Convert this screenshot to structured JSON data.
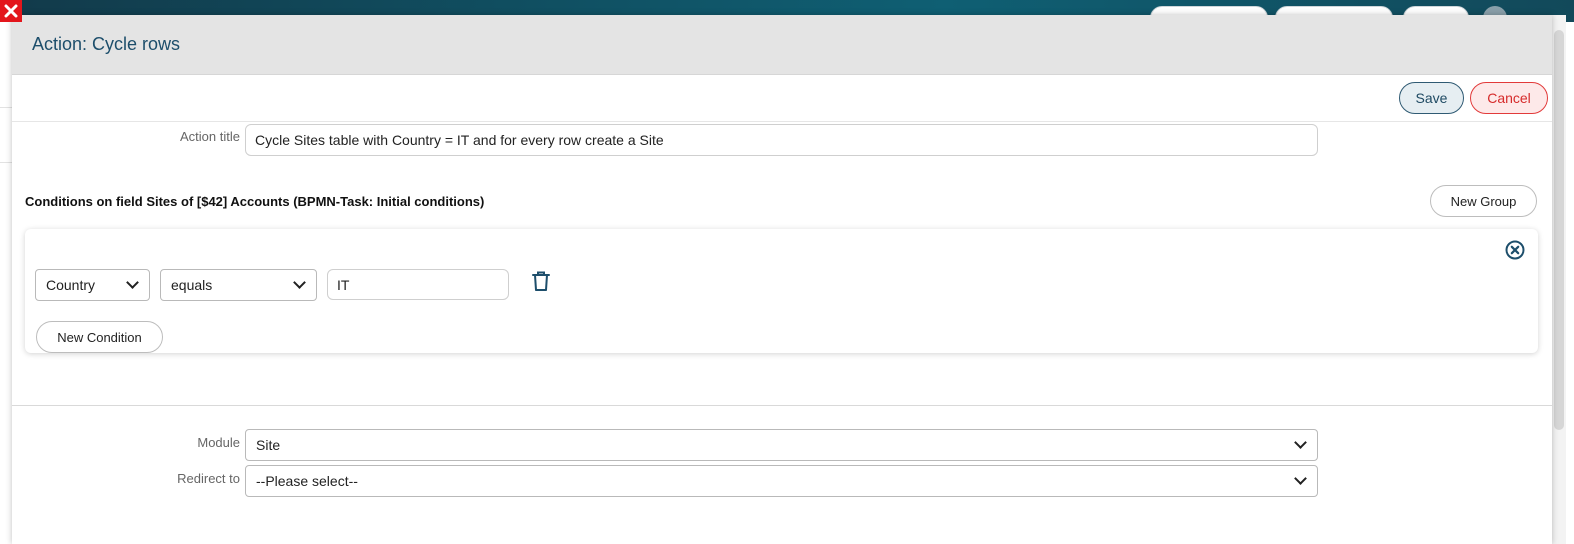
{
  "modal": {
    "title": "Action: Cycle rows",
    "save_label": "Save",
    "cancel_label": "Cancel"
  },
  "action_title": {
    "label": "Action title",
    "value": "Cycle Sites table with Country = IT and for every row create a Site"
  },
  "conditions": {
    "title": "Conditions on field Sites of [$42] Accounts (BPMN-Task: Initial conditions)",
    "new_group_label": "New Group",
    "groups": [
      {
        "rows": [
          {
            "field": "Country",
            "operator": "equals",
            "value": "IT"
          }
        ],
        "new_condition_label": "New Condition"
      }
    ]
  },
  "module": {
    "label": "Module",
    "value": "Site"
  },
  "redirect": {
    "label": "Redirect to",
    "value": "--Please select--"
  },
  "colors": {
    "accent": "#1d4e6b",
    "cancel": "#d62b2b",
    "close": "#e3161c"
  }
}
